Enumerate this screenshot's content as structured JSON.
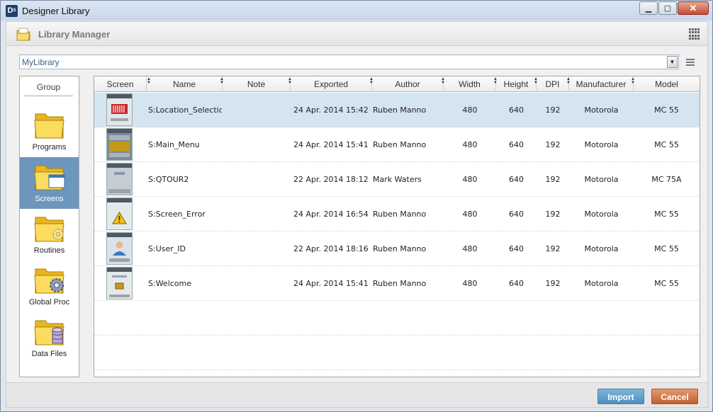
{
  "window": {
    "title": "Designer Library",
    "app_icon_letter": "D",
    "app_icon_sub": "S"
  },
  "header": {
    "title": "Library Manager"
  },
  "library_select": {
    "value": "MyLibrary"
  },
  "group_panel": {
    "heading": "Group",
    "items": [
      {
        "label": "Programs",
        "icon": "programs-folder-icon"
      },
      {
        "label": "Screens",
        "icon": "screens-folder-icon",
        "selected": true
      },
      {
        "label": "Routines",
        "icon": "routines-folder-icon"
      },
      {
        "label": "Global Proc",
        "icon": "global-proc-folder-icon"
      },
      {
        "label": "Data Files",
        "icon": "data-files-folder-icon"
      }
    ]
  },
  "table": {
    "columns": [
      "Screen",
      "Name",
      "Note",
      "Exported",
      "Author",
      "Width",
      "Height",
      "DPI",
      "Manufacturer",
      "Model"
    ],
    "rows": [
      {
        "name": "S:Location_Selectio",
        "note": "",
        "exported": "24 Apr. 2014 15:42",
        "author": "Ruben Manno",
        "width": "480",
        "height": "640",
        "dpi": "192",
        "manufacturer": "Motorola",
        "model": "MC 55",
        "thumb": "barcode"
      },
      {
        "name": "S:Main_Menu",
        "note": "",
        "exported": "24 Apr. 2014 15:41",
        "author": "Ruben Manno",
        "width": "480",
        "height": "640",
        "dpi": "192",
        "manufacturer": "Motorola",
        "model": "MC 55",
        "thumb": "menu"
      },
      {
        "name": "S:QTOUR2",
        "note": "",
        "exported": "22 Apr. 2014 18:12",
        "author": "Mark Waters",
        "width": "480",
        "height": "640",
        "dpi": "192",
        "manufacturer": "Motorola",
        "model": "MC 75A",
        "thumb": "plain"
      },
      {
        "name": "S:Screen_Error",
        "note": "",
        "exported": "24 Apr. 2014 16:54",
        "author": "Ruben Manno",
        "width": "480",
        "height": "640",
        "dpi": "192",
        "manufacturer": "Motorola",
        "model": "MC 55",
        "thumb": "warning"
      },
      {
        "name": "S:User_ID",
        "note": "",
        "exported": "22 Apr. 2014 18:16",
        "author": "Ruben Manno",
        "width": "480",
        "height": "640",
        "dpi": "192",
        "manufacturer": "Motorola",
        "model": "MC 55",
        "thumb": "user"
      },
      {
        "name": "S:Welcome",
        "note": "",
        "exported": "24 Apr. 2014 15:41",
        "author": "Ruben Manno",
        "width": "480",
        "height": "640",
        "dpi": "192",
        "manufacturer": "Motorola",
        "model": "MC 55",
        "thumb": "welcome"
      }
    ]
  },
  "footer": {
    "import_label": "Import",
    "cancel_label": "Cancel"
  },
  "colors": {
    "selected_group": "#6d96bd",
    "selected_row": "#d5e4f1",
    "import_button": "#4c8fbd",
    "cancel_button": "#c0612f"
  }
}
